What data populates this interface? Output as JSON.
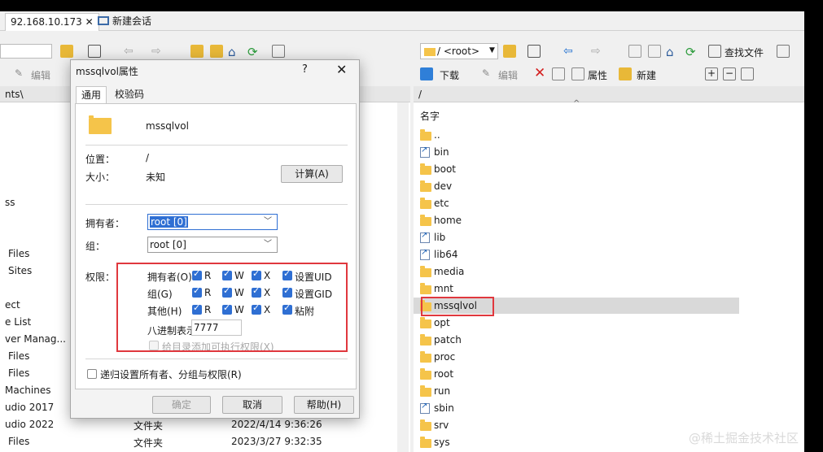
{
  "tabs": [
    {
      "label": "92.168.10.173 ✕"
    },
    {
      "label": "新建会话"
    }
  ],
  "left": {
    "toolbar_edit": "编辑",
    "path": "nts\\",
    "items": [
      "ss",
      "Files",
      "Sites",
      "ect",
      "e List",
      "ver Manag...",
      "Files",
      "Files",
      "Machines",
      "udio 2017",
      "udio 2022",
      "Files"
    ],
    "file_rows": [
      {
        "type": "文件夹",
        "date": "2022/4/14  9:36:26"
      },
      {
        "type": "文件夹",
        "date": "2023/3/27  9:32:35"
      }
    ]
  },
  "right": {
    "location": "/ <root>",
    "find_label": "查找文件",
    "download": "下载",
    "edit": "编辑",
    "properties": "属性",
    "new": "新建",
    "path": "/",
    "col_name": "名字",
    "files": [
      {
        "name": "..",
        "kind": "up"
      },
      {
        "name": "bin",
        "kind": "link"
      },
      {
        "name": "boot",
        "kind": "folder"
      },
      {
        "name": "dev",
        "kind": "folder"
      },
      {
        "name": "etc",
        "kind": "folder"
      },
      {
        "name": "home",
        "kind": "folder"
      },
      {
        "name": "lib",
        "kind": "link"
      },
      {
        "name": "lib64",
        "kind": "link"
      },
      {
        "name": "media",
        "kind": "folder"
      },
      {
        "name": "mnt",
        "kind": "folder"
      },
      {
        "name": "mssqlvol",
        "kind": "folder",
        "selected": true
      },
      {
        "name": "opt",
        "kind": "folder"
      },
      {
        "name": "patch",
        "kind": "folder"
      },
      {
        "name": "proc",
        "kind": "folder"
      },
      {
        "name": "root",
        "kind": "folder"
      },
      {
        "name": "run",
        "kind": "folder"
      },
      {
        "name": "sbin",
        "kind": "link"
      },
      {
        "name": "srv",
        "kind": "folder"
      },
      {
        "name": "sys",
        "kind": "folder"
      }
    ]
  },
  "dialog": {
    "title": "mssqlvol属性",
    "help_glyph": "?",
    "close_glyph": "✕",
    "tab_general": "通用",
    "tab_checksum": "校验码",
    "name": "mssqlvol",
    "location_label": "位置：",
    "location_value": "/",
    "size_label": "大小：",
    "size_value": "未知",
    "calc_button": "计算(A)",
    "owner_label": "拥有者：",
    "owner_value": "root [0]",
    "group_label": "组：",
    "group_value": "root [0]",
    "perm_label": "权限：",
    "perm_rows": [
      {
        "label": "拥有者(O)",
        "r": "R",
        "w": "W",
        "x": "X",
        "extra": "设置UID"
      },
      {
        "label": "组(G)",
        "r": "R",
        "w": "W",
        "x": "X",
        "extra": "设置GID"
      },
      {
        "label": "其他(H)",
        "r": "R",
        "w": "W",
        "x": "X",
        "extra": "粘附"
      }
    ],
    "octal_label": "八进制表示",
    "octal_value": "7777",
    "add_exec_label": "给目录添加可执行权限(X)",
    "recursive_label": "递归设置所有者、分组与权限(R)",
    "ok": "确定",
    "cancel": "取消",
    "help": "帮助(H)"
  },
  "watermark": "@稀土掘金技术社区"
}
